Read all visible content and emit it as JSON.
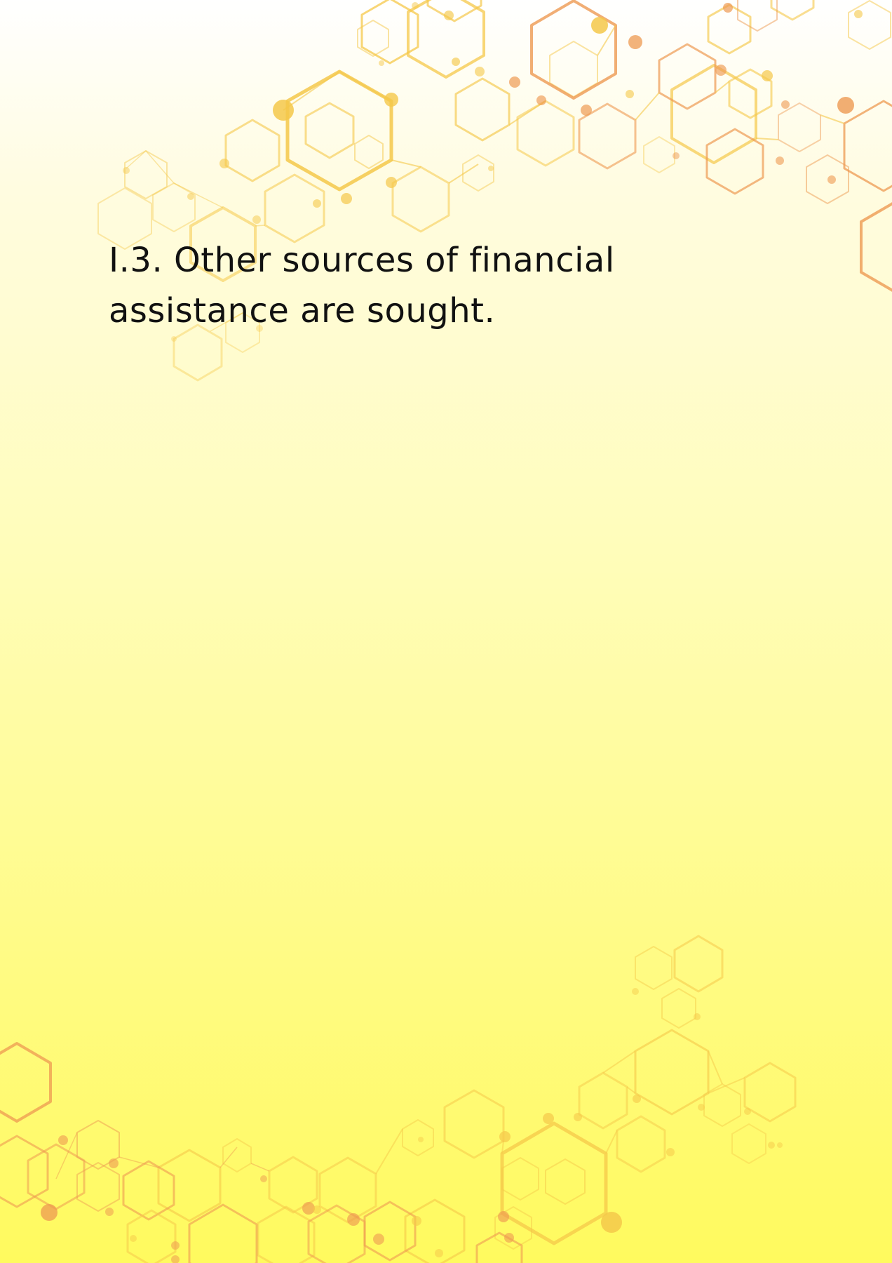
{
  "document": {
    "heading_line1": "I.3. Other sources of financial",
    "heading_line2": "assistance are sought."
  },
  "colors": {
    "text": "#111111",
    "hex_yellow": "#f5c84a",
    "hex_orange": "#ee9a52",
    "background_top": "#ffffff",
    "background_bottom": "#fffa5e"
  },
  "decorations": {
    "top_pattern": "hexagon-network-pattern",
    "bottom_pattern": "hexagon-network-pattern"
  }
}
